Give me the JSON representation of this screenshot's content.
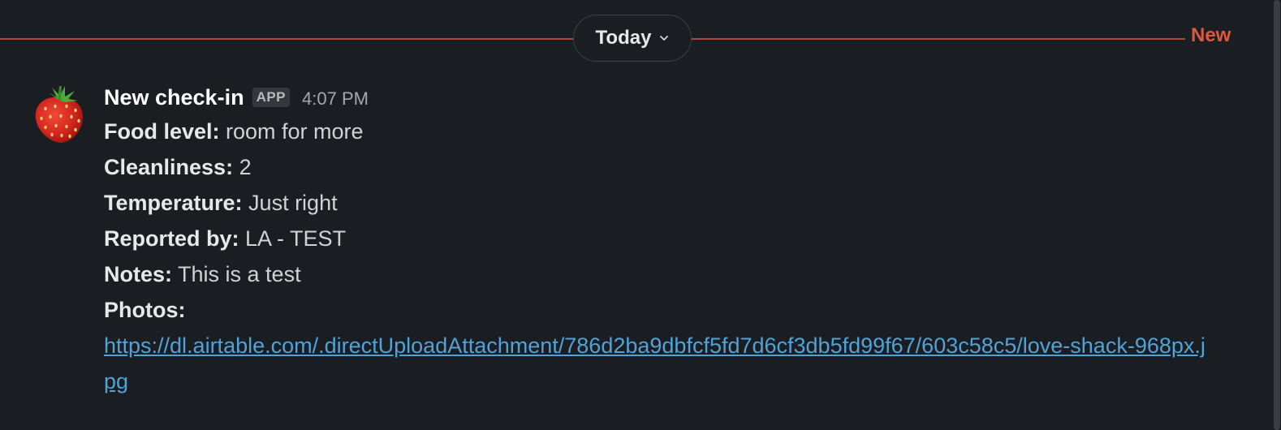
{
  "divider": {
    "label": "Today",
    "new_label": "New",
    "line_color": "#b5432f",
    "new_color": "#e0583b"
  },
  "message": {
    "avatar_icon": "strawberry-icon",
    "sender": "New check-in",
    "badge": "APP",
    "time": "4:07 PM",
    "fields": [
      {
        "label": "Food level:",
        "value": " room for more"
      },
      {
        "label": "Cleanliness:",
        "value": " 2"
      },
      {
        "label": "Temperature:",
        "value": " Just right"
      },
      {
        "label": "Reported by:",
        "value": " LA - TEST"
      },
      {
        "label": "Notes:",
        "value": " This is a test"
      },
      {
        "label": "Photos:",
        "value": ""
      }
    ],
    "photo_url": "https://dl.airtable.com/.directUploadAttachment/786d2ba9dbfcf5fd7d6cf3db5fd99f67/603c58c5/love-shack-968px.jpg",
    "link_color": "#4fa3d8"
  }
}
